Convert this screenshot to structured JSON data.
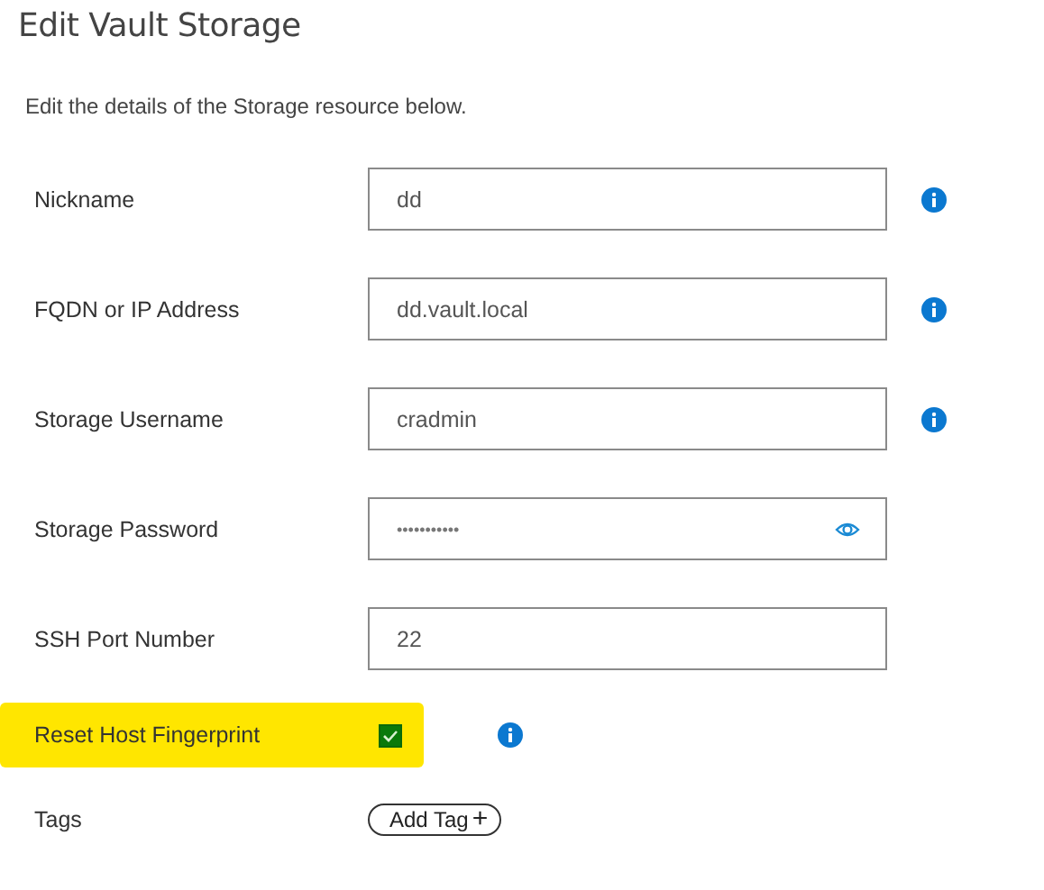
{
  "title": "Edit Vault Storage",
  "description": "Edit the details of the Storage resource below.",
  "fields": [
    {
      "kind": "text",
      "label": "Nickname",
      "value": "dd",
      "info": true
    },
    {
      "kind": "text",
      "label": "FQDN or IP Address",
      "value": "dd.vault.local",
      "info": true
    },
    {
      "kind": "text",
      "label": "Storage Username",
      "value": "cradmin",
      "info": true
    },
    {
      "kind": "password",
      "label": "Storage Password",
      "value": "•••••••••••",
      "info": false
    },
    {
      "kind": "text",
      "label": "SSH Port Number",
      "value": "22",
      "info": false
    },
    {
      "kind": "checkbox",
      "label": "Reset Host Fingerprint",
      "checked": true,
      "highlighted": true,
      "info": true
    },
    {
      "kind": "tags",
      "label": "Tags",
      "button": "Add Tag",
      "button_icon": "+",
      "info": false
    }
  ]
}
